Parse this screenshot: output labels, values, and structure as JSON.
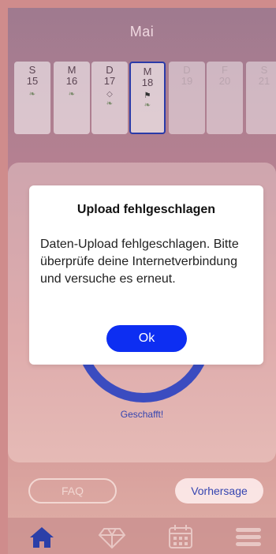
{
  "header": {
    "month": "Mai"
  },
  "days": [
    {
      "weekday": "S",
      "date": "15",
      "icons": [
        "sprout-icon"
      ],
      "state": "past"
    },
    {
      "weekday": "M",
      "date": "16",
      "icons": [
        "sprout-icon"
      ],
      "state": "past"
    },
    {
      "weekday": "D",
      "date": "17",
      "icons": [
        "gem-icon",
        "sprout-icon"
      ],
      "state": "past"
    },
    {
      "weekday": "M",
      "date": "18",
      "icons": [
        "flag-icon",
        "sprout-icon"
      ],
      "state": "selected"
    },
    {
      "weekday": "D",
      "date": "19",
      "icons": [],
      "state": "future"
    },
    {
      "weekday": "F",
      "date": "20",
      "icons": [],
      "state": "future"
    },
    {
      "weekday": "S",
      "date": "21",
      "icons": [],
      "state": "future"
    }
  ],
  "progress": {
    "label": "Geschafft!"
  },
  "buttons": {
    "faq": "FAQ",
    "forecast": "Vorhersage"
  },
  "tabs": [
    "home-icon",
    "gem-icon",
    "calendar-icon",
    "menu-icon"
  ],
  "dialog": {
    "title": "Upload fehlgeschlagen",
    "message": "Daten-Upload fehlgeschlagen. Bitte überprüfe deine Internetverbindung und versuche es erneut.",
    "ok_label": "Ok"
  },
  "colors": {
    "accent": "#0d2ef2",
    "ring": "#3b4cc0",
    "tab_active": "#2b3fa8"
  }
}
